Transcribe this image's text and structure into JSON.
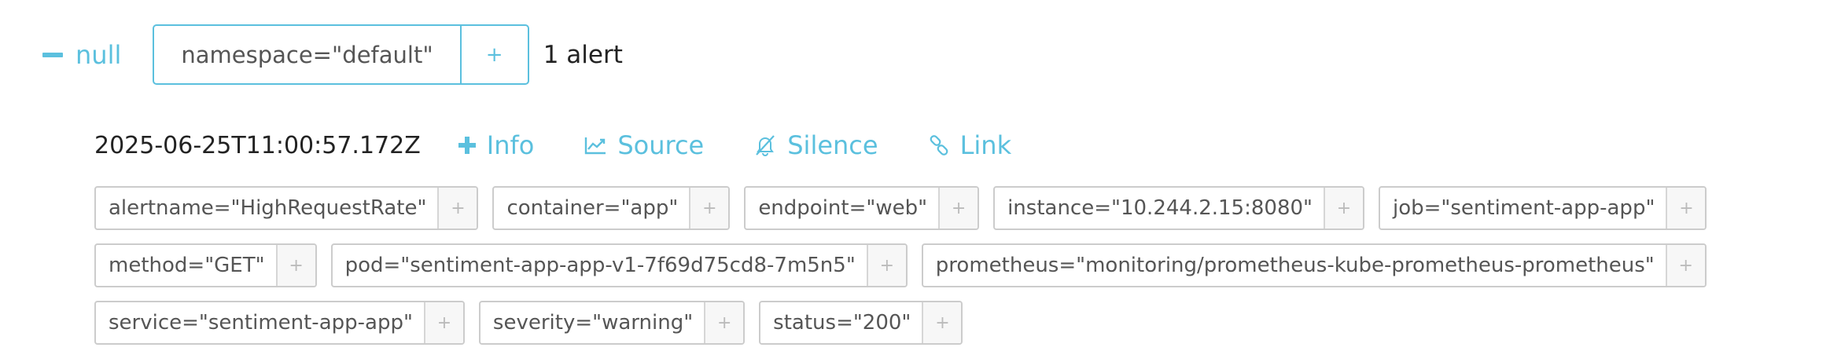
{
  "group": {
    "toggle_icon": "minus-icon",
    "name": "null",
    "filter": "namespace=\"default\"",
    "filter_add": "+",
    "count": "1 alert"
  },
  "alert": {
    "timestamp": "2025-06-25T11:00:57.172Z",
    "actions": {
      "info": "Info",
      "source": "Source",
      "silence": "Silence",
      "link": "Link"
    },
    "add_symbol": "+",
    "labels": [
      "alertname=\"HighRequestRate\"",
      "container=\"app\"",
      "endpoint=\"web\"",
      "instance=\"10.244.2.15:8080\"",
      "job=\"sentiment-app-app\"",
      "method=\"GET\"",
      "pod=\"sentiment-app-app-v1-7f69d75cd8-7m5n5\"",
      "prometheus=\"monitoring/prometheus-kube-prometheus-prometheus\"",
      "service=\"sentiment-app-app\"",
      "severity=\"warning\"",
      "status=\"200\""
    ]
  },
  "colors": {
    "accent": "#5bc0de",
    "label_border": "#cccccc",
    "text": "#555555"
  }
}
